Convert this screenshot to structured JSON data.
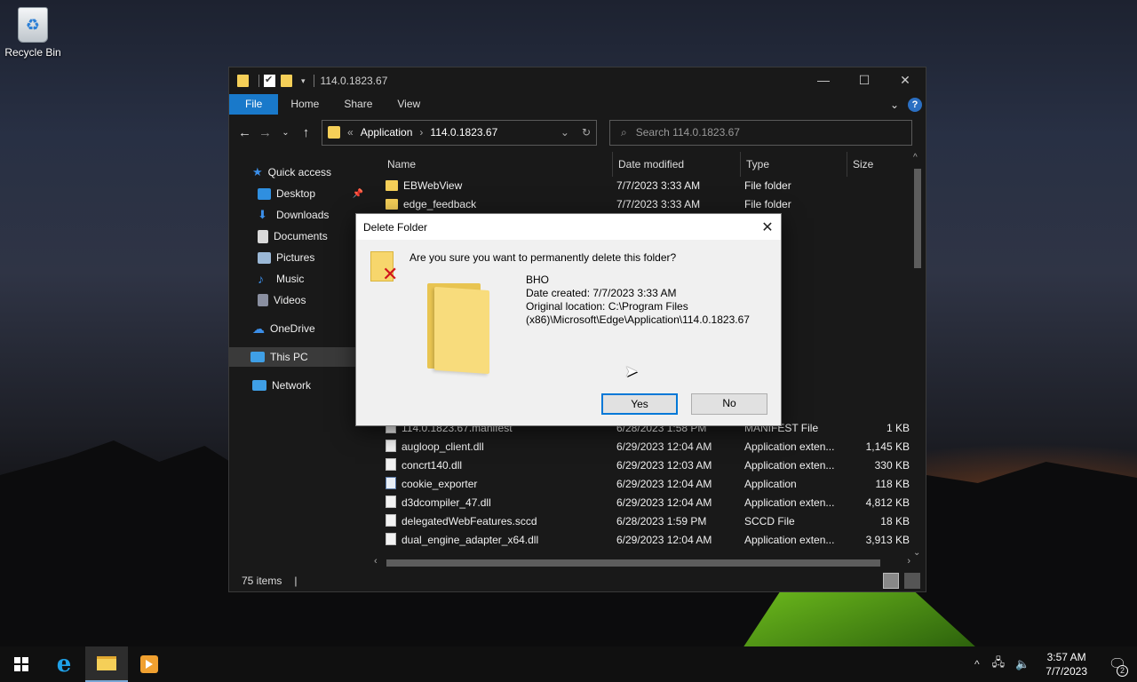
{
  "desktop": {
    "recycle_bin_label": "Recycle Bin"
  },
  "explorer": {
    "title": "114.0.1823.67",
    "ribbon_tabs": [
      "File",
      "Home",
      "Share",
      "View"
    ],
    "address": {
      "crumbs": [
        "Application",
        "114.0.1823.67"
      ]
    },
    "search_placeholder": "Search 114.0.1823.67",
    "nav": {
      "quick_access": "Quick access",
      "desktop": "Desktop",
      "downloads": "Downloads",
      "documents": "Documents",
      "pictures": "Pictures",
      "music": "Music",
      "videos": "Videos",
      "onedrive": "OneDrive",
      "this_pc": "This PC",
      "network": "Network"
    },
    "columns": {
      "name": "Name",
      "date": "Date modified",
      "type": "Type",
      "size": "Size"
    },
    "files": [
      {
        "name": "EBWebView",
        "date": "7/7/2023 3:33 AM",
        "type": "File folder",
        "size": "",
        "icon": "folder"
      },
      {
        "name": "edge_feedback",
        "date": "7/7/2023 3:33 AM",
        "type": "File folder",
        "size": "",
        "icon": "folder"
      },
      {
        "name": "",
        "date": "",
        "type": "der",
        "size": "",
        "icon": "folder"
      },
      {
        "name": "",
        "date": "",
        "type": "der",
        "size": "",
        "icon": "folder"
      },
      {
        "name": "",
        "date": "",
        "type": "der",
        "size": "",
        "icon": "folder"
      },
      {
        "name": "",
        "date": "",
        "type": "der",
        "size": "",
        "icon": "folder"
      },
      {
        "name": "",
        "date": "",
        "type": "der",
        "size": "",
        "icon": "folder"
      },
      {
        "name": "",
        "date": "",
        "type": "der",
        "size": "",
        "icon": "folder"
      },
      {
        "name": "",
        "date": "",
        "type": "der",
        "size": "",
        "icon": "folder"
      },
      {
        "name": "",
        "date": "",
        "type": "der",
        "size": "",
        "icon": "folder"
      },
      {
        "name": "",
        "date": "",
        "type": "der",
        "size": "",
        "icon": "folder"
      },
      {
        "name": "",
        "date": "",
        "type": "der",
        "size": "",
        "icon": "folder"
      },
      {
        "name": "",
        "date": "",
        "type": "der",
        "size": "",
        "icon": "folder"
      },
      {
        "name": "114.0.1823.67.manifest",
        "date": "6/28/2023 1:58 PM",
        "type": "MANIFEST File",
        "size": "1 KB",
        "icon": "doc"
      },
      {
        "name": "augloop_client.dll",
        "date": "6/29/2023 12:04 AM",
        "type": "Application exten...",
        "size": "1,145 KB",
        "icon": "doc"
      },
      {
        "name": "concrt140.dll",
        "date": "6/29/2023 12:03 AM",
        "type": "Application exten...",
        "size": "330 KB",
        "icon": "doc"
      },
      {
        "name": "cookie_exporter",
        "date": "6/29/2023 12:04 AM",
        "type": "Application",
        "size": "118 KB",
        "icon": "app"
      },
      {
        "name": "d3dcompiler_47.dll",
        "date": "6/29/2023 12:04 AM",
        "type": "Application exten...",
        "size": "4,812 KB",
        "icon": "doc"
      },
      {
        "name": "delegatedWebFeatures.sccd",
        "date": "6/28/2023 1:59 PM",
        "type": "SCCD File",
        "size": "18 KB",
        "icon": "doc"
      },
      {
        "name": "dual_engine_adapter_x64.dll",
        "date": "6/29/2023 12:04 AM",
        "type": "Application exten...",
        "size": "3,913 KB",
        "icon": "doc"
      }
    ],
    "status": "75 items"
  },
  "dialog": {
    "title": "Delete Folder",
    "question": "Are you sure you want to permanently delete this folder?",
    "folder_name": "BHO",
    "date_created": "Date created: 7/7/2023 3:33 AM",
    "location_line1": "Original location: C:\\Program Files",
    "location_line2": "(x86)\\Microsoft\\Edge\\Application\\114.0.1823.67",
    "yes_label": "Yes",
    "no_label": "No"
  },
  "taskbar": {
    "time": "3:57 AM",
    "date": "7/7/2023",
    "notification_count": "2"
  }
}
